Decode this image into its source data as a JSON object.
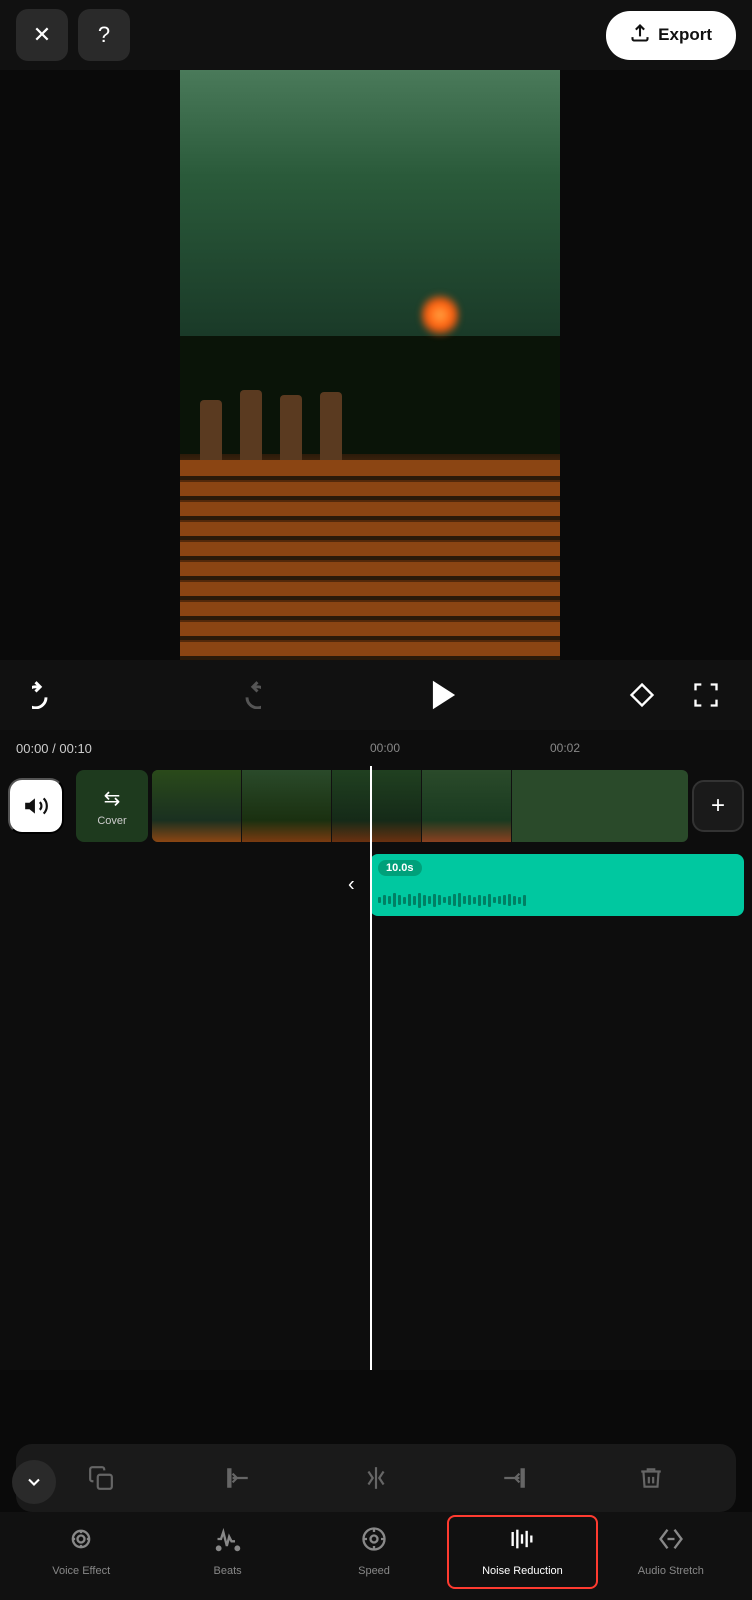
{
  "topBar": {
    "closeLabel": "✕",
    "helpLabel": "?",
    "exportLabel": "Export"
  },
  "playback": {
    "undoIcon": "↩",
    "redoIcon": "↪",
    "playIcon": "▶",
    "keyframeIcon": "◇",
    "fullscreenIcon": "⛶",
    "timeDisplay": "00:00 / 00:10"
  },
  "timeline": {
    "markers": [
      "00:00",
      "00:00",
      "00:02"
    ],
    "currentTime": "00:00",
    "totalTime": "00:10"
  },
  "tracks": {
    "volumeIcon": "🔊",
    "coverLabel": "Cover",
    "addLabel": "+",
    "audioDuration": "10.0s"
  },
  "bottomToolbar": {
    "icons": [
      "copy",
      "trim-start",
      "split",
      "trim-end",
      "delete"
    ]
  },
  "bottomNav": {
    "items": [
      {
        "id": "voice-effect",
        "label": "Voice Effect",
        "icon": "voice"
      },
      {
        "id": "beats",
        "label": "Beats",
        "icon": "beats"
      },
      {
        "id": "speed",
        "label": "Speed",
        "icon": "speed"
      },
      {
        "id": "noise-reduction",
        "label": "Noise Reduction",
        "icon": "noise",
        "active": true
      },
      {
        "id": "audio-stretch",
        "label": "Audio Stretch",
        "icon": "stretch"
      }
    ],
    "collapseIcon": "∨"
  }
}
